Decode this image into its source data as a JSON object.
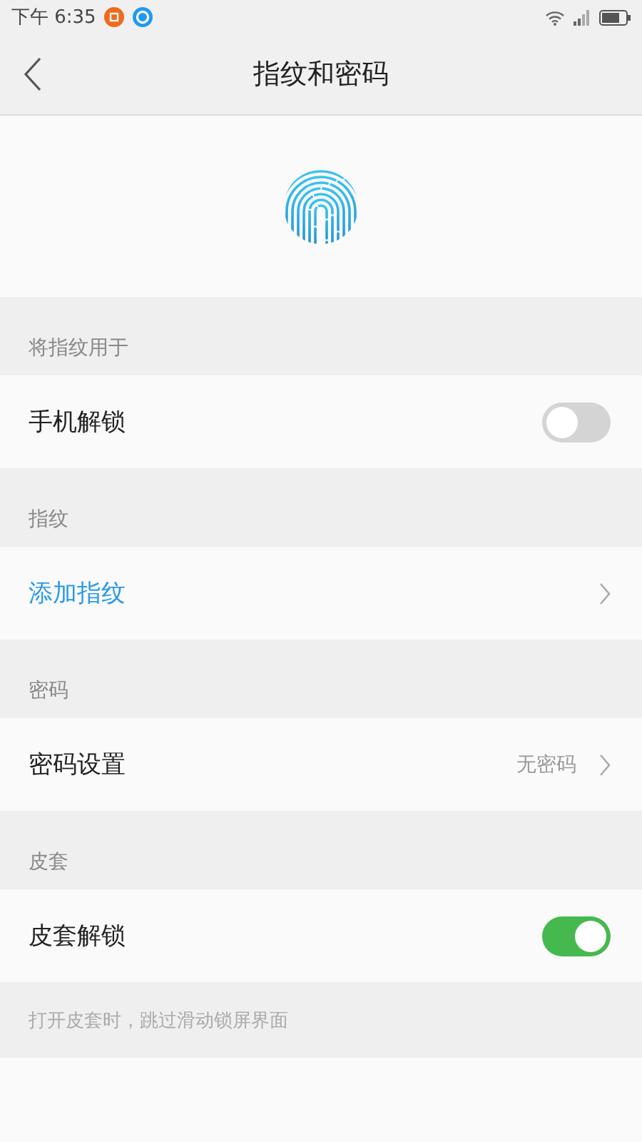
{
  "status_bar": {
    "time": "下午 6:35"
  },
  "nav": {
    "title": "指纹和密码"
  },
  "sections": [
    {
      "header": "将指纹用于",
      "rows": [
        {
          "kind": "toggle",
          "label": "手机解锁",
          "on": false
        }
      ]
    },
    {
      "header": "指纹",
      "rows": [
        {
          "kind": "action",
          "label": "添加指纹"
        }
      ]
    },
    {
      "header": "密码",
      "rows": [
        {
          "kind": "link",
          "label": "密码设置",
          "value": "无密码"
        }
      ]
    },
    {
      "header": "皮套",
      "rows": [
        {
          "kind": "toggle",
          "label": "皮套解锁",
          "on": true
        }
      ],
      "note": "打开皮套时，跳过滑动锁屏界面"
    }
  ]
}
